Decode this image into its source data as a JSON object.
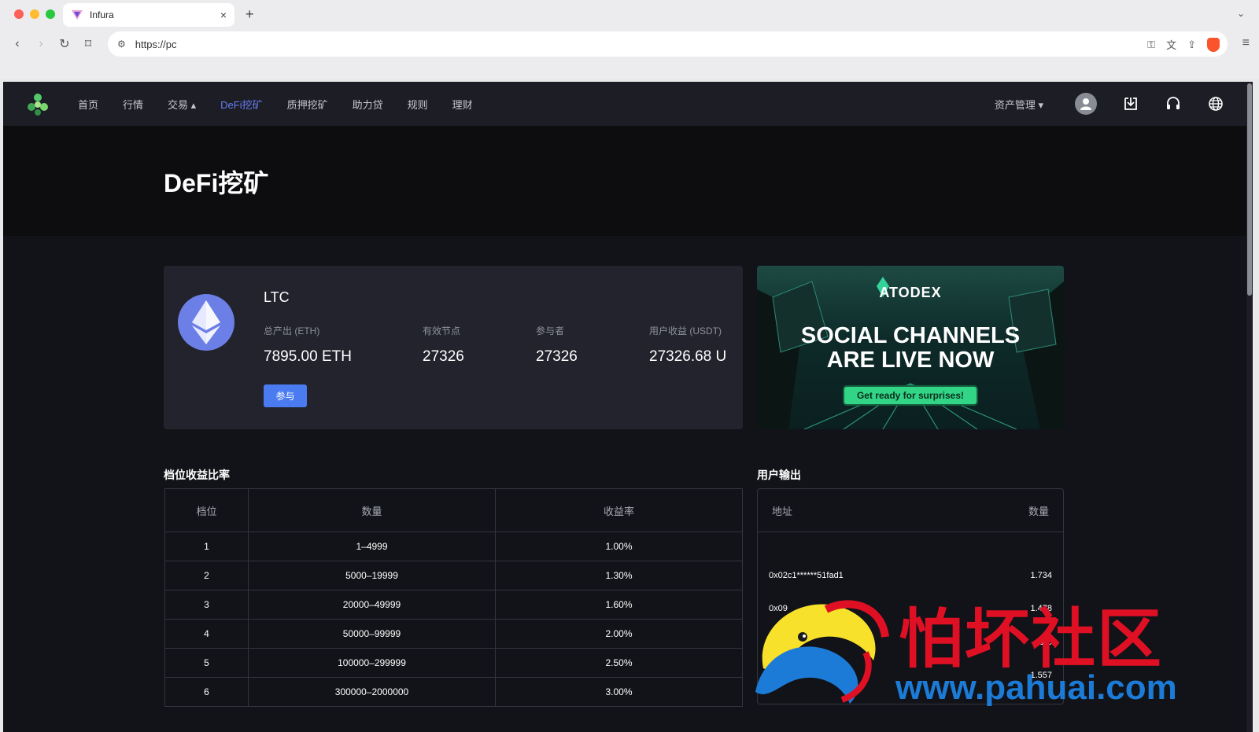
{
  "browser": {
    "tab_title": "Infura",
    "new_tab_symbol": "+",
    "tab_close_symbol": "×",
    "url": "https://pc"
  },
  "nav": {
    "items": [
      {
        "label": "首页",
        "active": false
      },
      {
        "label": "行情",
        "active": false
      },
      {
        "label": "交易 ▴",
        "active": false
      },
      {
        "label": "DeFi挖矿",
        "active": true
      },
      {
        "label": "质押挖矿",
        "active": false
      },
      {
        "label": "助力贷",
        "active": false
      },
      {
        "label": "规则",
        "active": false
      },
      {
        "label": "理财",
        "active": false
      }
    ],
    "asset_management": "资产管理 ▾"
  },
  "hero": {
    "title": "DeFi挖矿"
  },
  "coin": {
    "name": "LTC",
    "stats": [
      {
        "label": "总产出 (ETH)",
        "value": "7895.00 ETH"
      },
      {
        "label": "有效节点",
        "value": "27326"
      },
      {
        "label": "参与者",
        "value": "27326"
      },
      {
        "label": "用户收益 (USDT)",
        "value": "27326.68 U"
      }
    ],
    "join_label": "参与"
  },
  "banner": {
    "brand": "ATODEX",
    "headline_line1": "SOCIAL CHANNELS",
    "headline_line2": "ARE LIVE NOW",
    "cta": "Get ready for surprises!"
  },
  "tier_section": {
    "title": "档位收益比率",
    "columns": [
      "档位",
      "数量",
      "收益率"
    ],
    "rows": [
      [
        "1",
        "1–4999",
        "1.00%"
      ],
      [
        "2",
        "5000–19999",
        "1.30%"
      ],
      [
        "3",
        "20000–49999",
        "1.60%"
      ],
      [
        "4",
        "50000–99999",
        "2.00%"
      ],
      [
        "5",
        "100000–299999",
        "2.50%"
      ],
      [
        "6",
        "300000–2000000",
        "3.00%"
      ]
    ]
  },
  "user_output": {
    "title": "用户输出",
    "columns": [
      "地址",
      "数量"
    ],
    "rows": [
      {
        "address": "0x02c1******51fad1",
        "amount": "1.734"
      },
      {
        "address": "0x09",
        "amount": "1.478"
      },
      {
        "address": "0",
        "amount": "1.6"
      },
      {
        "address": "",
        "amount": "1.557"
      }
    ]
  },
  "watermark": {
    "text": "怕坏社区",
    "url": "www.pahuai.com"
  },
  "colors": {
    "accent": "#6b7df2",
    "button": "#4a7bf1",
    "background": "#121318",
    "card": "#22232c",
    "eth": "#6c7fe6"
  }
}
